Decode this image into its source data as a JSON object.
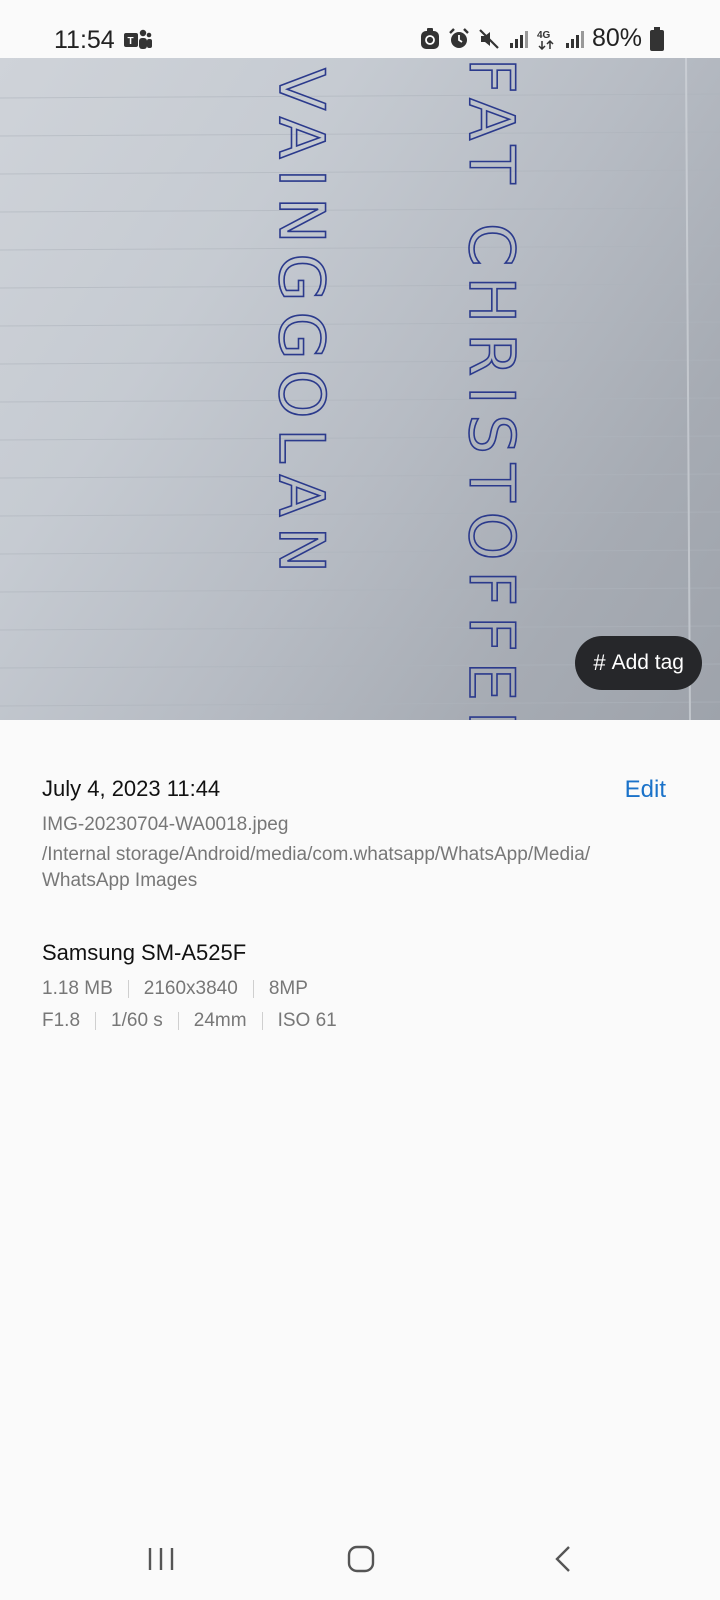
{
  "status_bar": {
    "time": "11:54",
    "network": "4G",
    "battery": "80%",
    "icons": [
      "teams-icon",
      "assistant-icon",
      "alarm-icon",
      "mute-icon",
      "signal-icon",
      "data-icon",
      "battery-icon"
    ]
  },
  "photo": {
    "handwriting": [
      "FAT CHRISTOFFEL",
      "VAINGGOLAN"
    ],
    "add_tag_hash": "#",
    "add_tag_label": "Add tag"
  },
  "details": {
    "date": "July 4, 2023 11:44",
    "edit_label": "Edit",
    "filename": "IMG-20230704-WA0018.jpeg",
    "path": "/Internal storage/Android/media/com.whatsapp/WhatsApp/Media/ WhatsApp Images",
    "device": "Samsung SM-A525F",
    "file_info": [
      "1.18 MB",
      "2160x3840",
      "8MP"
    ],
    "camera_info": [
      "F1.8",
      "1/60 s",
      "24mm",
      "ISO 61"
    ]
  },
  "nav": {
    "icons": [
      "recents-icon",
      "home-icon",
      "back-icon"
    ]
  },
  "colors": {
    "accent": "#1a72c9",
    "tag_bg": "#26272a",
    "ink": "#2b3a8c"
  }
}
